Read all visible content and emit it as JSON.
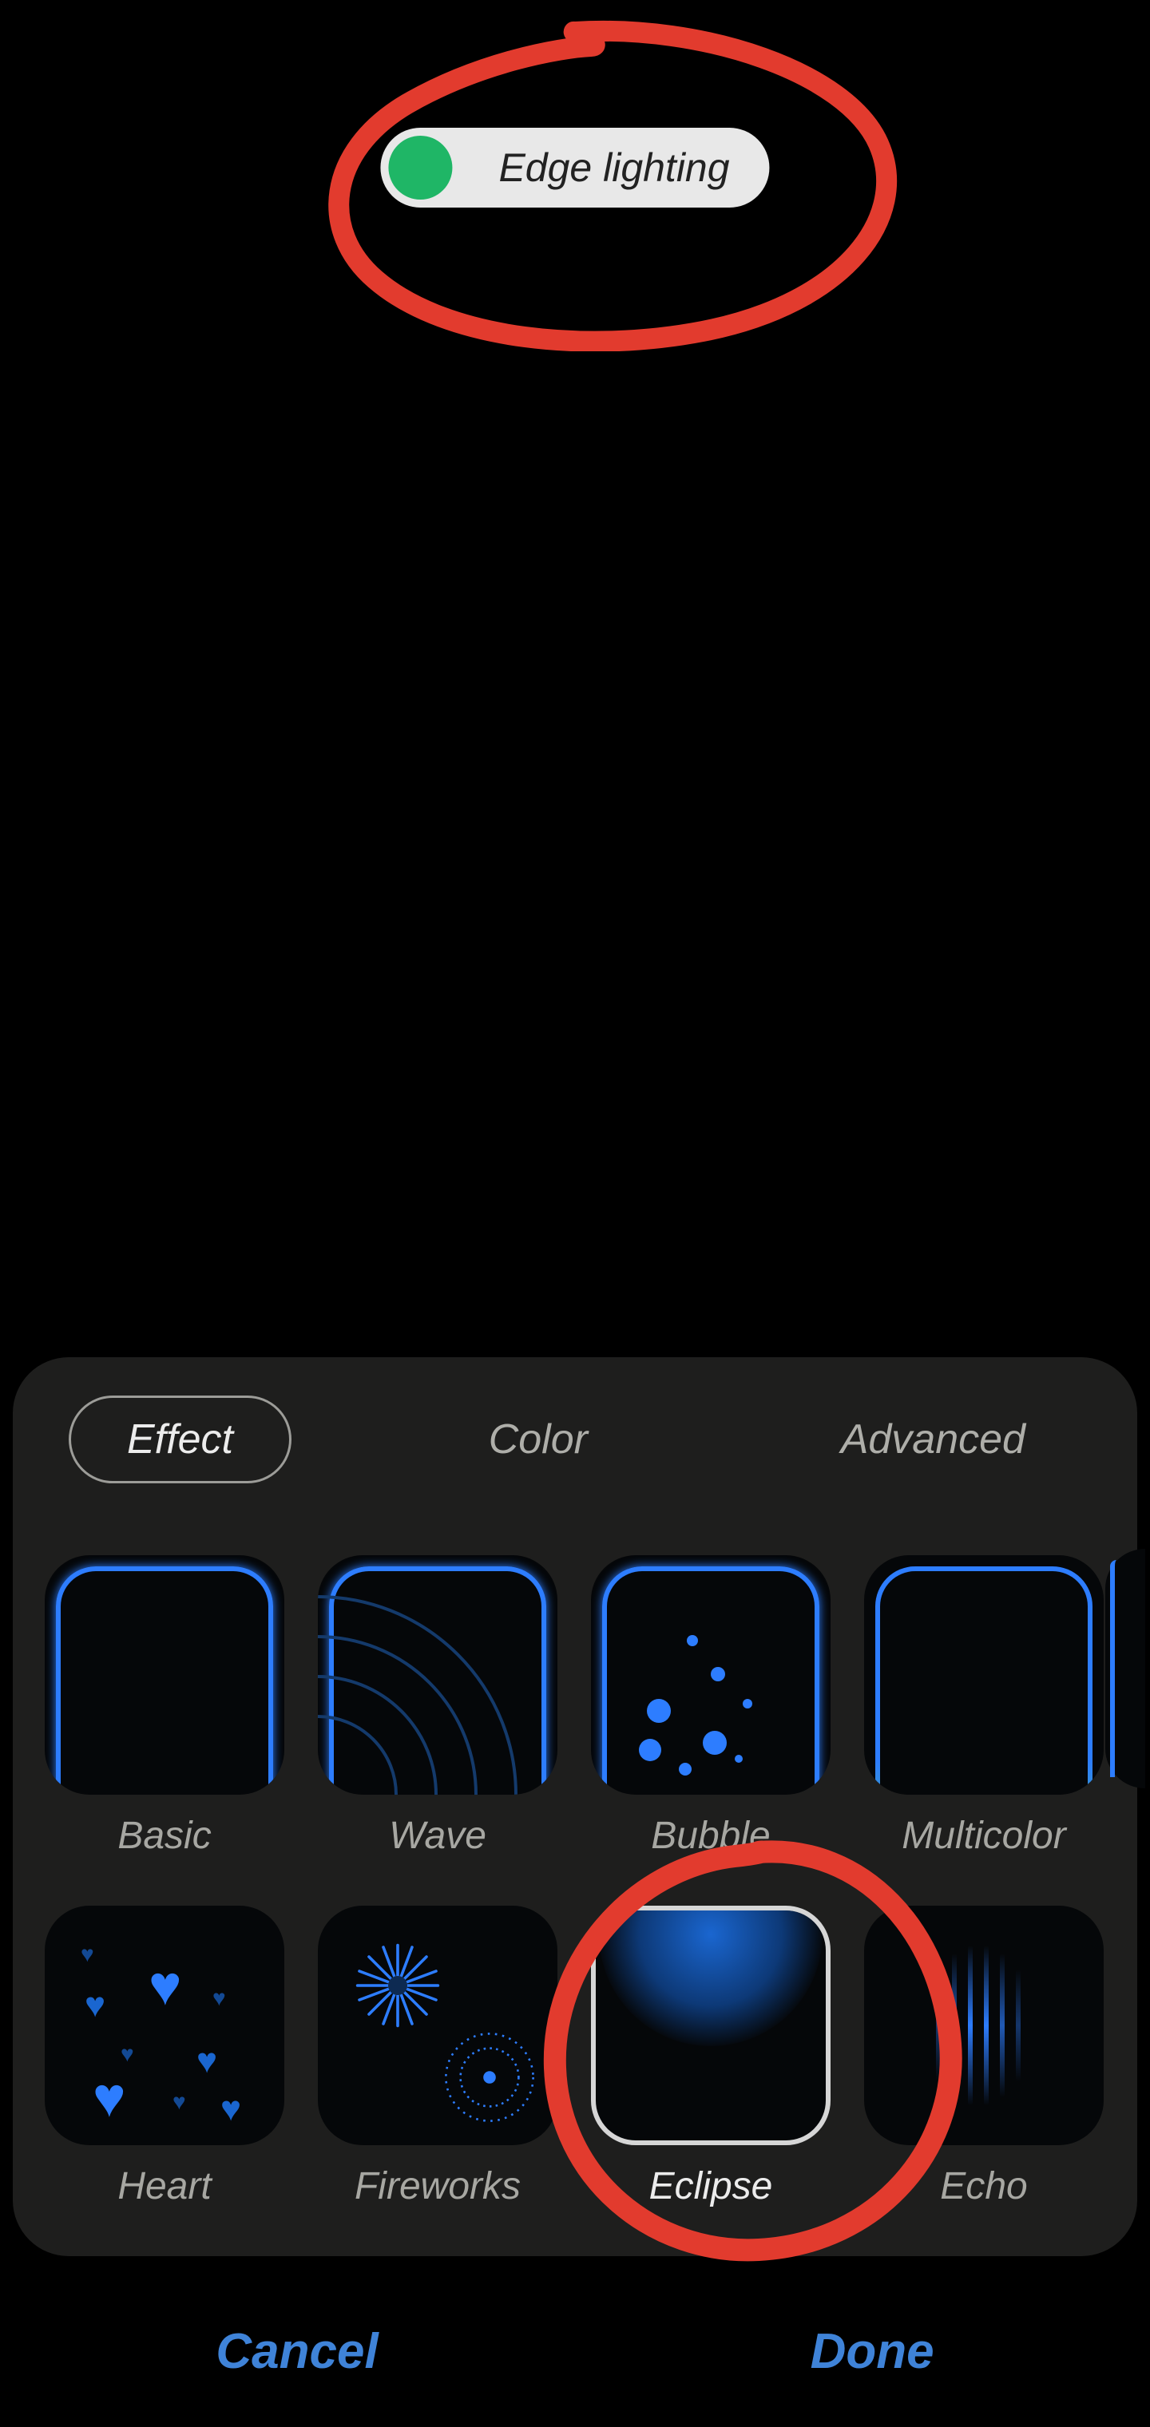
{
  "toggle": {
    "label": "Edge lighting",
    "enabled": true
  },
  "sheet": {
    "tabs": [
      {
        "label": "Effect",
        "active": true
      },
      {
        "label": "Color",
        "active": false
      },
      {
        "label": "Advanced",
        "active": false
      }
    ],
    "effects": [
      {
        "id": "basic",
        "label": "Basic",
        "selected": false
      },
      {
        "id": "wave",
        "label": "Wave",
        "selected": false
      },
      {
        "id": "bubble",
        "label": "Bubble",
        "selected": false
      },
      {
        "id": "multicolor",
        "label": "Multicolor",
        "selected": false
      },
      {
        "id": "heart",
        "label": "Heart",
        "selected": false
      },
      {
        "id": "fireworks",
        "label": "Fireworks",
        "selected": false
      },
      {
        "id": "eclipse",
        "label": "Eclipse",
        "selected": true
      },
      {
        "id": "echo",
        "label": "Echo",
        "selected": false
      }
    ]
  },
  "footer": {
    "cancel": "Cancel",
    "done": "Done"
  },
  "annotation": {
    "circles_toggle": true,
    "circles_eclipse": true,
    "color": "#e23b2e"
  }
}
